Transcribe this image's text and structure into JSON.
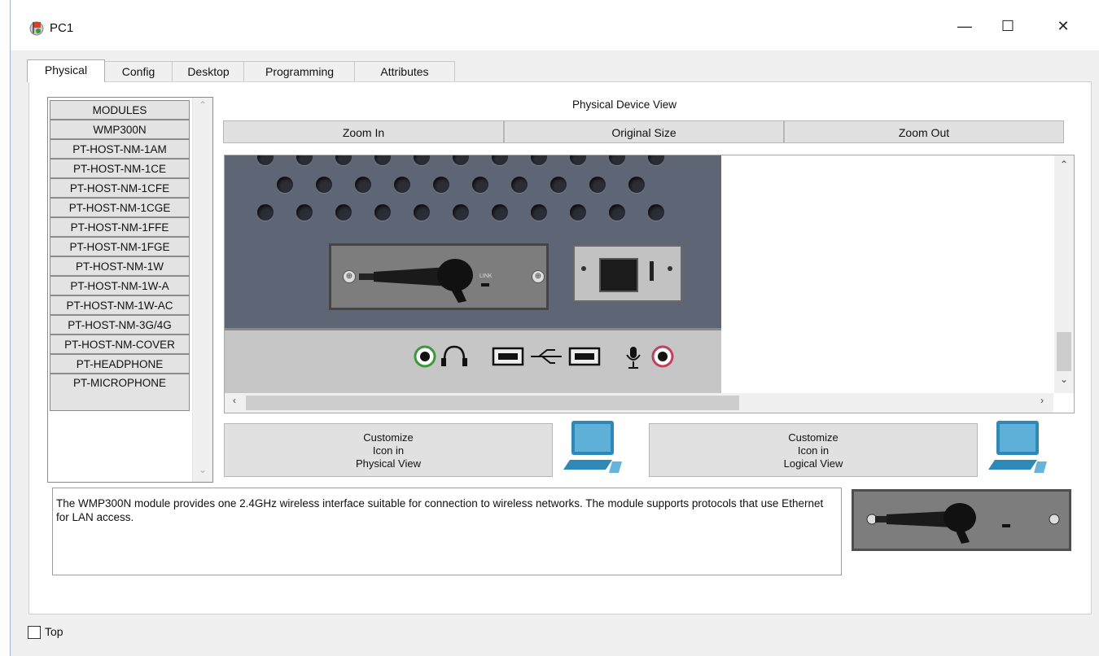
{
  "window": {
    "title": "PC1",
    "minimize_glyph": "—",
    "maximize_glyph": "☐",
    "close_glyph": "✕"
  },
  "tabs": [
    {
      "label": "Physical",
      "active": true
    },
    {
      "label": "Config",
      "active": false
    },
    {
      "label": "Desktop",
      "active": false
    },
    {
      "label": "Programming",
      "active": false
    },
    {
      "label": "Attributes",
      "active": false
    }
  ],
  "modules": {
    "header": "MODULES",
    "items": [
      "WMP300N",
      "PT-HOST-NM-1AM",
      "PT-HOST-NM-1CE",
      "PT-HOST-NM-1CFE",
      "PT-HOST-NM-1CGE",
      "PT-HOST-NM-1FFE",
      "PT-HOST-NM-1FGE",
      "PT-HOST-NM-1W",
      "PT-HOST-NM-1W-A",
      "PT-HOST-NM-1W-AC",
      "PT-HOST-NM-3G/4G",
      "PT-HOST-NM-COVER",
      "PT-HEADPHONE",
      "PT-MICROPHONE"
    ]
  },
  "physical_view": {
    "title": "Physical Device View",
    "zoom_in": "Zoom In",
    "original_size": "Original Size",
    "zoom_out": "Zoom Out",
    "card_label": "LINK"
  },
  "customize": {
    "physical": [
      "Customize",
      "Icon in",
      "Physical View"
    ],
    "logical": [
      "Customize",
      "Icon in",
      "Logical View"
    ]
  },
  "description": "The WMP300N module provides one 2.4GHz wireless interface suitable for connection to wireless networks. The module supports protocols that use Ethernet for LAN access.",
  "footer": {
    "top_label": "Top",
    "top_checked": false
  }
}
